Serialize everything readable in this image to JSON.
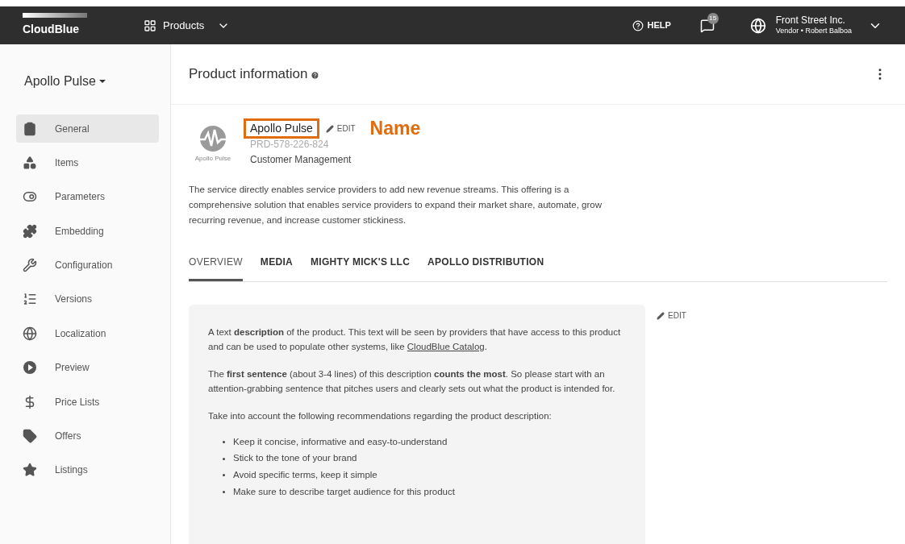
{
  "topbar": {
    "brand": "CloudBlue",
    "menu": "Products",
    "help": "HELP",
    "notifications": "15",
    "account": {
      "company": "Front Street Inc.",
      "role": "Vendor • Robert Balboa"
    }
  },
  "sidebar": {
    "product": "Apollo Pulse",
    "items": [
      {
        "label": "General",
        "selected": true
      },
      {
        "label": "Items",
        "selected": false
      },
      {
        "label": "Parameters",
        "selected": false
      },
      {
        "label": "Embedding",
        "selected": false
      },
      {
        "label": "Configuration",
        "selected": false
      },
      {
        "label": "Versions",
        "selected": false
      },
      {
        "label": "Localization",
        "selected": false
      },
      {
        "label": "Preview",
        "selected": false
      },
      {
        "label": "Price Lists",
        "selected": false
      },
      {
        "label": "Offers",
        "selected": false
      },
      {
        "label": "Listings",
        "selected": false
      }
    ]
  },
  "header": {
    "title": "Product information"
  },
  "product": {
    "logo_caption": "Apollo Pulse",
    "name": "Apollo Pulse",
    "edit": "EDIT",
    "annotation": "Name",
    "id": "PRD-578-226-824",
    "category": "Customer Management",
    "summary": "The service directly enables service providers to add new revenue streams. This offering is a comprehensive solution that enables service providers to expand their market share, automate, grow recurring revenue, and increase customer stickiness."
  },
  "tabs": [
    {
      "label": "OVERVIEW",
      "selected": true
    },
    {
      "label": "MEDIA",
      "selected": false
    },
    {
      "label": "MIGHTY MICK'S LLC",
      "selected": false
    },
    {
      "label": "APOLLO DISTRIBUTION",
      "selected": false
    }
  ],
  "overview": {
    "edit": "EDIT",
    "intro": {
      "text": "A text **description** of the product. This text will be seen by providers that have access to this product and can be used to populate other systems, like",
      "link": "CloudBlue Catalog",
      "after": "."
    },
    "paragraphs": [
      "The **first sentence** (about 3-4 lines) of this description **counts the most**. So please start with an attention-grabbing sentence that pitches users and clearly sets out what the product is intended for.",
      "Take into account the following recommendations regarding the product description:"
    ],
    "bullets": [
      "Keep it concise, informative and easy-to-understand",
      "Stick to the tone of your brand",
      "Avoid specific terms, keep it simple",
      "Make sure to describe target audience for this product"
    ]
  }
}
